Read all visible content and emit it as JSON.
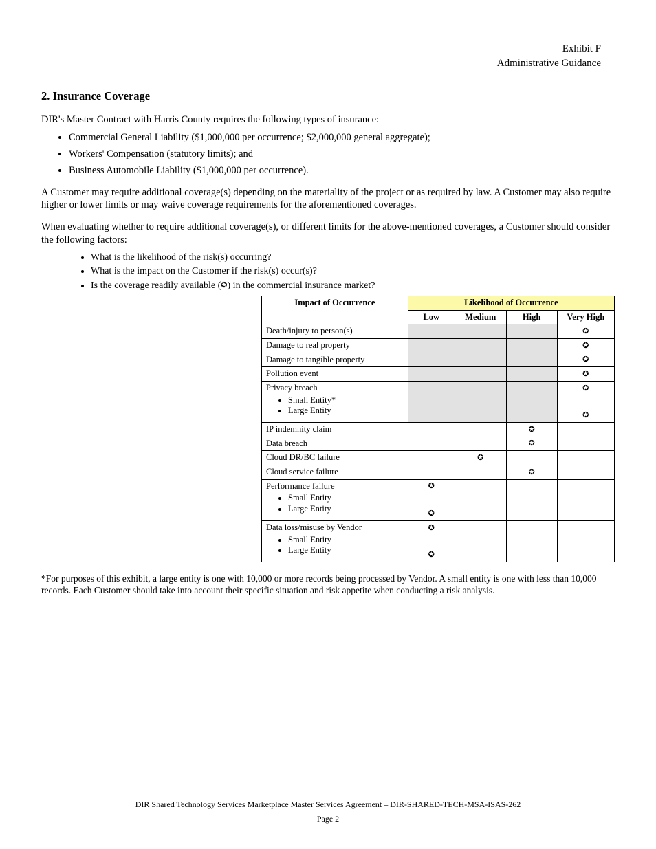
{
  "header": {
    "line1": "Exhibit F",
    "line2": "Administrative Guidance"
  },
  "section": {
    "title": "2.  Insurance Coverage",
    "intro": "DIR's Master Contract with Harris County requires the following types of insurance:",
    "bullets": [
      "Commercial General Liability ($1,000,000 per occurrence; $2,000,000 general aggregate);",
      "Workers' Compensation (statutory limits); and",
      "Business Automobile Liability ($1,000,000 per occurrence)."
    ],
    "para2": "A Customer may require additional coverage(s) depending on the materiality of the project or as required by law. A Customer may also require higher or lower limits or may waive coverage requirements for the aforementioned coverages.",
    "para3": "When evaluating whether to require additional coverage(s), or different limits for the above-mentioned coverages, a Customer should consider the following factors:",
    "sub_bullets": [
      "What is the likelihood of the risk(s) occurring?",
      "What is the impact on the Customer if the risk(s) occur(s)?",
      "Is the coverage readily available (",
      ") in the commercial insurance market?"
    ]
  },
  "table": {
    "header_group": "Likelihood of Occurrence",
    "col_label": "Impact of Occurrence",
    "cols": [
      "Low",
      "Medium",
      "High",
      "Very High"
    ],
    "rows": [
      {
        "label": "Death/injury to person(s)",
        "stars": [
          null,
          null,
          null,
          "VH"
        ],
        "shade": [
          true,
          true,
          true,
          false
        ]
      },
      {
        "label": "Damage to real property",
        "stars": [
          null,
          null,
          null,
          "VH"
        ],
        "shade": [
          true,
          true,
          true,
          false
        ]
      },
      {
        "label": "Damage to tangible property",
        "stars": [
          null,
          null,
          null,
          "VH"
        ],
        "shade": [
          true,
          true,
          true,
          false
        ]
      },
      {
        "label": "Pollution event",
        "stars": [
          null,
          null,
          null,
          "VH"
        ],
        "shade": [
          true,
          true,
          true,
          false
        ]
      },
      {
        "label": "Privacy breach",
        "sub": [
          "Small Entity*",
          "Large Entity"
        ],
        "stars": [
          null,
          null,
          null,
          "both"
        ],
        "shade": [
          true,
          true,
          true,
          false
        ]
      },
      {
        "label": "IP indemnity claim",
        "stars": [
          null,
          null,
          "H",
          null
        ],
        "shade": [
          false,
          false,
          false,
          false
        ]
      },
      {
        "label": "Data breach",
        "stars": [
          null,
          null,
          "H",
          null
        ],
        "shade": [
          false,
          false,
          false,
          false
        ]
      },
      {
        "label": "Cloud DR/BC failure",
        "stars": [
          null,
          "M",
          null,
          null
        ],
        "shade": [
          false,
          false,
          false,
          false
        ]
      },
      {
        "label": "Cloud service failure",
        "stars": [
          null,
          null,
          "H",
          null
        ],
        "shade": [
          false,
          false,
          false,
          false
        ]
      },
      {
        "label": "Performance failure",
        "sub": [
          "Small Entity",
          "Large Entity"
        ],
        "stars": [
          "both",
          null,
          null,
          null
        ],
        "shade": [
          false,
          false,
          false,
          false
        ]
      },
      {
        "label": "Data loss/misuse by Vendor",
        "sub": [
          "Small Entity",
          "Large Entity"
        ],
        "stars": [
          "both",
          null,
          null,
          null
        ],
        "shade": [
          false,
          false,
          false,
          false
        ]
      }
    ]
  },
  "footnote": "*For purposes of this exhibit, a large entity is one with 10,000 or more records being processed by Vendor. A small entity is one with less than 10,000 records. Each Customer should take into account their specific situation and risk appetite when conducting a risk analysis.",
  "footer": {
    "doc": "DIR Shared Technology Services Marketplace Master Services Agreement – DIR-SHARED-TECH-MSA-ISAS-262",
    "page": "Page 2"
  },
  "star_glyph": "✪"
}
